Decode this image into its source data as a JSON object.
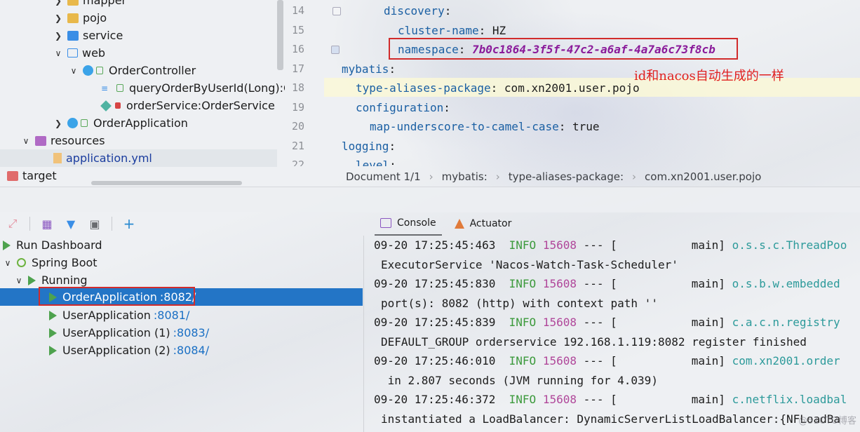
{
  "tree": {
    "items": [
      {
        "label": "mapper"
      },
      {
        "label": "pojo"
      },
      {
        "label": "service"
      },
      {
        "label": "web"
      },
      {
        "label": "OrderController"
      },
      {
        "label": "queryOrderByUserId(Long):Or"
      },
      {
        "label": "orderService:OrderService"
      },
      {
        "label": "OrderApplication"
      },
      {
        "label": "resources"
      },
      {
        "label": "application.yml"
      },
      {
        "label": "target"
      }
    ]
  },
  "editor": {
    "line_numbers": [
      "14",
      "15",
      "16",
      "17",
      "18",
      "19",
      "20",
      "21",
      "22"
    ],
    "lines": [
      {
        "key": "discovery",
        "sep": ":",
        "value": ""
      },
      {
        "key": "cluster-name",
        "sep": ": ",
        "value": "HZ"
      },
      {
        "key": "namespace",
        "sep": ": ",
        "value": "7b0c1864-3f5f-47c2-a6af-4a7a6c73f8cb"
      },
      {
        "key": "mybatis",
        "sep": ":",
        "value": ""
      },
      {
        "key": "type-aliases-package",
        "sep": ": ",
        "value": "com.xn2001.user.pojo"
      },
      {
        "key": "configuration",
        "sep": ":",
        "value": ""
      },
      {
        "key": "map-underscore-to-camel-case",
        "sep": ": ",
        "value": "true"
      },
      {
        "key": "logging",
        "sep": ":",
        "value": ""
      },
      {
        "key": "level",
        "sep": ":",
        "value": ""
      }
    ],
    "annotation": "id和nacos自动生成的一样"
  },
  "breadcrumb": [
    "Document 1/1",
    "mybatis:",
    "type-aliases-package:",
    "com.xn2001.user.pojo"
  ],
  "services": {
    "items": [
      {
        "label": "Run Dashboard"
      },
      {
        "label": "Spring Boot"
      },
      {
        "label": "Running"
      },
      {
        "label": "OrderApplication",
        "port": ":8082/"
      },
      {
        "label": "UserApplication",
        "port": ":8081/"
      },
      {
        "label": "UserApplication (1)",
        "port": ":8083/"
      },
      {
        "label": "UserApplication (2)",
        "port": ":8084/"
      }
    ]
  },
  "tabs": [
    "Console",
    "Actuator"
  ],
  "console": {
    "lines": [
      {
        "ts": "09-20 17:25:45:463",
        "level": "INFO",
        "pid": "15608",
        "mid": " --- [           main] ",
        "logger": "o.s.s.c.ThreadPoo"
      },
      {
        "text": "ExecutorService 'Nacos-Watch-Task-Scheduler'"
      },
      {
        "ts": "09-20 17:25:45:830",
        "level": "INFO",
        "pid": "15608",
        "mid": " --- [           main] ",
        "logger": "o.s.b.w.embedded"
      },
      {
        "text": "port(s): 8082 (http) with context path ''"
      },
      {
        "ts": "09-20 17:25:45:839",
        "level": "INFO",
        "pid": "15608",
        "mid": " --- [           main] ",
        "logger": "c.a.c.n.registry"
      },
      {
        "text": "DEFAULT_GROUP orderservice 192.168.1.119:8082 register finished"
      },
      {
        "ts": "09-20 17:25:46:010",
        "level": "INFO",
        "pid": "15608",
        "mid": " --- [           main] ",
        "logger": "com.xn2001.order"
      },
      {
        "text": " in 2.807 seconds (JVM running for 4.039)"
      },
      {
        "ts": "09-20 17:25:46:372",
        "level": "INFO",
        "pid": "15608",
        "mid": " --- [           main] ",
        "logger": "c.netflix.loadbal"
      },
      {
        "text": "instantiated a LoadBalancer: DynamicServerListLoadBalancer:{NFLoadBa"
      }
    ],
    "watermark": "@51CTO博客"
  },
  "colors": {
    "accent": "#2375c6",
    "highlight_box": "#d12b2b",
    "annotation": "#e02020"
  }
}
